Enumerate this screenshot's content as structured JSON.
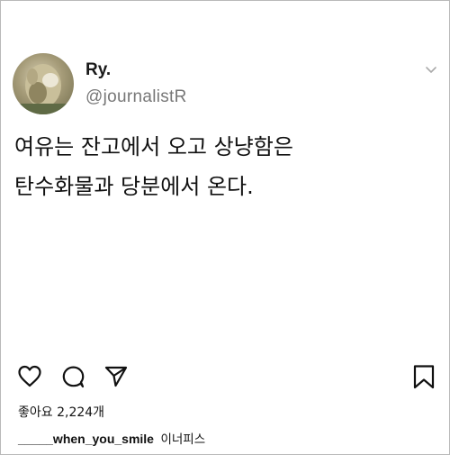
{
  "post": {
    "author": {
      "name": "Ry.",
      "handle": "@journalistR"
    },
    "text_lines": [
      "여유는 잔고에서 오고 상냥함은",
      "탄수화물과 당분에서 온다."
    ]
  },
  "actions": {
    "icons": [
      "heart-icon",
      "comment-icon",
      "share-icon",
      "bookmark-icon"
    ]
  },
  "likes": {
    "label": "좋아요 2,224개"
  },
  "caption": {
    "username": "_____when_you_smile",
    "text": "이너피스"
  }
}
